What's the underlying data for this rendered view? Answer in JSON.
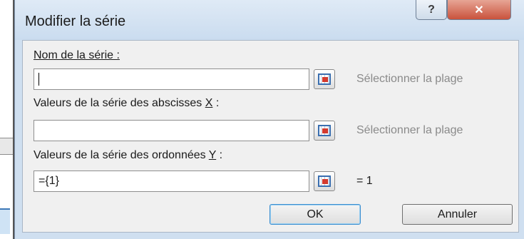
{
  "dialog": {
    "title": "Modifier la série",
    "help_glyph": "?",
    "close_glyph": "✕"
  },
  "fields": {
    "name": {
      "label": "Nom de la série :",
      "value": "",
      "hint": "Sélectionner la plage"
    },
    "x_values": {
      "label_pre": "Valeurs de la série des abscisses ",
      "label_key": "X",
      "label_post": " :",
      "value": "",
      "hint": "Sélectionner la plage"
    },
    "y_values": {
      "label_pre": "Valeurs de la série des ordonnées ",
      "label_key": "Y",
      "label_post": " :",
      "value": "={1}",
      "result": "= 1"
    }
  },
  "buttons": {
    "ok": "OK",
    "cancel": "Annuler"
  }
}
